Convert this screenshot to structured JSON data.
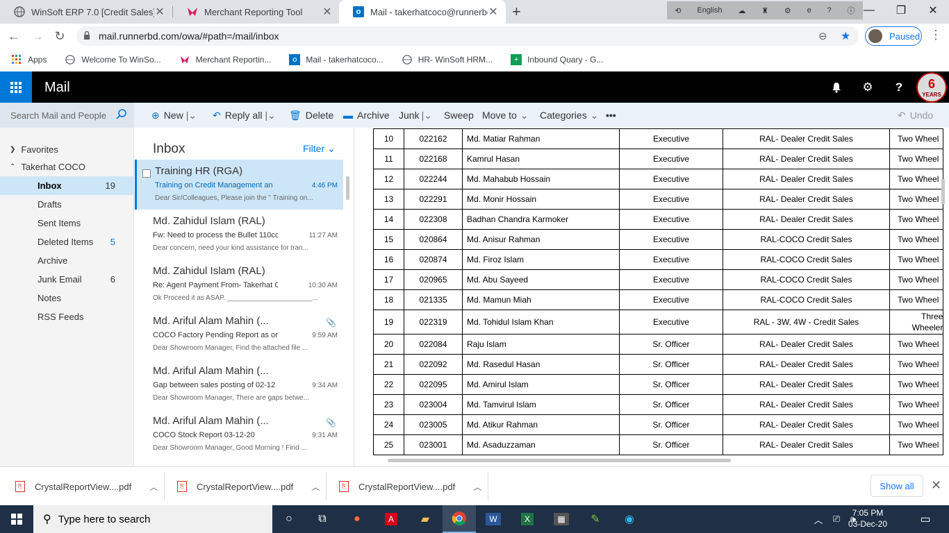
{
  "browser": {
    "tabs": [
      {
        "title": "WinSoft ERP 7.0 [Credit Sales]",
        "icon": "globe-icon"
      },
      {
        "title": "Merchant Reporting Tool",
        "icon": "merchant-icon"
      },
      {
        "title": "Mail - takerhatcoco@runnerbd.co",
        "icon": "outlook-icon"
      }
    ],
    "language": "English",
    "url": "mail.runnerbd.com/owa/#path=/mail/inbox",
    "profile_status": "Paused",
    "bookmarks": [
      {
        "label": "Apps",
        "icon": "apps-grid-icon"
      },
      {
        "label": "Welcome To WinSo...",
        "icon": "globe-icon"
      },
      {
        "label": "Merchant Reportin...",
        "icon": "merchant-icon"
      },
      {
        "label": "Mail - takerhatcoco...",
        "icon": "outlook-icon"
      },
      {
        "label": "HR- WinSoft HRM...",
        "icon": "globe-icon"
      },
      {
        "label": "Inbound Quary - G...",
        "icon": "sheets-icon"
      }
    ]
  },
  "owa": {
    "app_name": "Mail",
    "search_placeholder": "Search Mail and People",
    "commands": {
      "new": "New",
      "reply_all": "Reply all",
      "delete": "Delete",
      "archive": "Archive",
      "junk": "Junk",
      "sweep": "Sweep",
      "move_to": "Move to",
      "categories": "Categories",
      "more": "•••",
      "undo": "Undo"
    },
    "folders": {
      "favorites": "Favorites",
      "account": "Takerhat COCO",
      "items": [
        {
          "label": "Inbox",
          "count": "19"
        },
        {
          "label": "Drafts",
          "count": ""
        },
        {
          "label": "Sent Items",
          "count": ""
        },
        {
          "label": "Deleted Items",
          "count": "5"
        },
        {
          "label": "Archive",
          "count": ""
        },
        {
          "label": "Junk Email",
          "count": "6"
        },
        {
          "label": "Notes",
          "count": ""
        },
        {
          "label": "RSS Feeds",
          "count": ""
        }
      ]
    },
    "list": {
      "title": "Inbox",
      "filter": "Filter",
      "messages": [
        {
          "from": "Training HR (RGA)",
          "subject": "Training on Credit Management an",
          "time": "4:46 PM",
          "preview": "Dear Sir/Colleagues, Please join the \" Training on..."
        },
        {
          "from": "Md. Zahidul Islam (RAL)",
          "subject": "Fw: Need to process the Bullet 110cc",
          "time": "11:27 AM",
          "preview": "Dear concern, need your kind assistance for tran..."
        },
        {
          "from": "Md. Zahidul Islam (RAL)",
          "subject": "Re: Agent Payment From- Takerhat COCO",
          "time": "10:30 AM",
          "preview": "Ok Proceed it as ASAP. ______________________..."
        },
        {
          "from": "Md. Ariful Alam Mahin (...",
          "subject": "COCO Factory Pending Report as on",
          "time": "9:59 AM",
          "preview": "Dear Showroom Manager, Find the attached file ..."
        },
        {
          "from": "Md. Ariful Alam Mahin (...",
          "subject": "Gap between sales posting of 02-12",
          "time": "9:34 AM",
          "preview": "Dear Showroom Manager, There are gaps betwe..."
        },
        {
          "from": "Md. Ariful Alam Mahin (...",
          "subject": "COCO Stock Report 03-12-20",
          "time": "9:31 AM",
          "preview": "Dear Showroom Manager, Good Morning ! Find ..."
        }
      ]
    },
    "table_rows": [
      [
        "10",
        "022162",
        "Md. Matiar Rahman",
        "Executive",
        "RAL- Dealer Credit Sales",
        "Two Wheel"
      ],
      [
        "11",
        "022168",
        "Kamrul Hasan",
        "Executive",
        "RAL- Dealer Credit Sales",
        "Two Wheel"
      ],
      [
        "12",
        "022244",
        "Md. Mahabub Hossain",
        "Executive",
        "RAL- Dealer Credit Sales",
        "Two Wheel"
      ],
      [
        "13",
        "022291",
        "Md. Monir Hossain",
        "Executive",
        "RAL- Dealer Credit Sales",
        "Two Wheel"
      ],
      [
        "14",
        "022308",
        "Badhan Chandra Karmoker",
        "Executive",
        "RAL- Dealer Credit Sales",
        "Two Wheel"
      ],
      [
        "15",
        "020864",
        "Md. Anisur Rahman",
        "Executive",
        "RAL-COCO Credit Sales",
        "Two Wheel"
      ],
      [
        "16",
        "020874",
        "Md. Firoz Islam",
        "Executive",
        "RAL-COCO Credit Sales",
        "Two Wheel"
      ],
      [
        "17",
        "020965",
        "Md. Abu Sayeed",
        "Executive",
        "RAL-COCO Credit Sales",
        "Two Wheel"
      ],
      [
        "18",
        "021335",
        "Md. Mamun Miah",
        "Executive",
        "RAL-COCO Credit Sales",
        "Two Wheel"
      ],
      [
        "19",
        "022319",
        "Md. Tohidul Islam Khan",
        "Executive",
        "RAL - 3W, 4W - Credit Sales",
        "Three Wheeler"
      ],
      [
        "20",
        "022084",
        "Raju Islam",
        "Sr. Officer",
        "RAL- Dealer Credit Sales",
        "Two Wheel"
      ],
      [
        "21",
        "022092",
        "Md. Rasedul Hasan",
        "Sr. Officer",
        "RAL- Dealer Credit Sales",
        "Two Wheel"
      ],
      [
        "22",
        "022095",
        "Md. Amirul Islam",
        "Sr. Officer",
        "RAL- Dealer Credit Sales",
        "Two Wheel"
      ],
      [
        "23",
        "023004",
        "Md. Tamvirul Islam",
        "Sr. Officer",
        "RAL- Dealer Credit Sales",
        "Two Wheel"
      ],
      [
        "24",
        "023005",
        "Md. Atikur Rahman",
        "Sr. Officer",
        "RAL- Dealer Credit Sales",
        "Two Wheel"
      ],
      [
        "25",
        "023001",
        "Md. Asaduzzaman",
        "Sr. Officer",
        "RAL- Dealer Credit Sales",
        "Two Wheel"
      ]
    ]
  },
  "downloads": {
    "items": [
      "CrystalReportView....pdf",
      "CrystalReportView....pdf",
      "CrystalReportView....pdf"
    ],
    "show_all": "Show all"
  },
  "taskbar": {
    "search_placeholder": "Type here to search",
    "time": "7:05 PM",
    "date": "03-Dec-20"
  },
  "colors": {
    "owa_blue": "#0078d7",
    "header_black": "#000000",
    "selected_bg": "#cde6f7",
    "taskbar": "#1f2f45"
  }
}
